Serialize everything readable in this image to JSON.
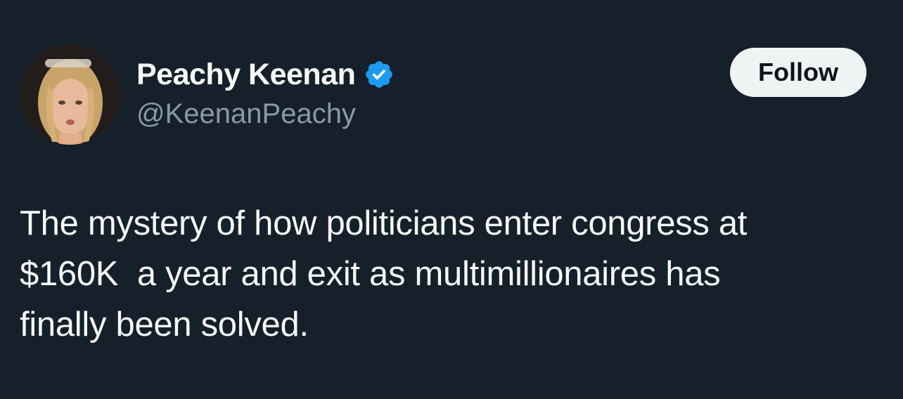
{
  "author": {
    "display_name": "Peachy Keenan",
    "handle": "@KeenanPeachy",
    "verified": true,
    "avatar_icon": "profile-photo"
  },
  "actions": {
    "follow_label": "Follow"
  },
  "tweet": {
    "text": "The mystery of how politicians enter congress at\n$160K  a year and exit as multimillionaires has\nfinally been solved."
  },
  "colors": {
    "background": "#15202b",
    "text_primary": "#f7f9f9",
    "text_secondary": "#8b98a5",
    "verified_badge": "#1d9bf0",
    "follow_button_bg": "#eff3f4",
    "follow_button_text": "#0f1419"
  }
}
